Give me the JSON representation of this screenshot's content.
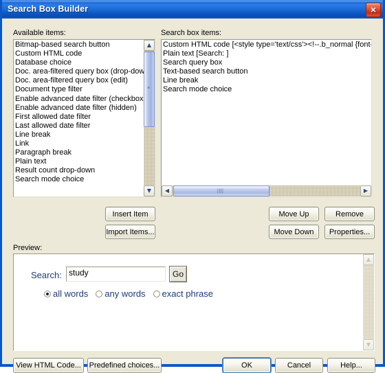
{
  "window": {
    "title": "Search Box Builder",
    "close_icon": "close-icon",
    "close_glyph": "×",
    "titlebar_color": "#1b6ad6",
    "face_color": "#ece9d8"
  },
  "available": {
    "label": "Available items:",
    "items": [
      "Bitmap-based search button",
      "Custom HTML code",
      "Database choice",
      "Doc. area-filtered query box (drop-down)",
      "Doc. area-filtered query box (edit)",
      "Document type filter",
      "Enable advanced date filter (checkbox)",
      "Enable advanced date filter (hidden)",
      "First allowed date filter",
      "Last allowed date filter",
      "Line break",
      "Link",
      "Paragraph break",
      "Plain text",
      "Result count drop-down",
      "Search mode choice"
    ],
    "scrollbar": {
      "up_glyph": "▲",
      "down_glyph": "▼",
      "grip_glyph": "≡"
    }
  },
  "searchbox": {
    "label": "Search box items:",
    "items": [
      "Custom HTML code [<style type='text/css'><!--.b_normal {font-size",
      "Plain text [Search: ]",
      "Search query box",
      "Text-based search button",
      "Line break",
      "Search mode choice"
    ],
    "scrollbar": {
      "left_glyph": "◀",
      "right_glyph": "▶",
      "grip_glyph": "||||"
    }
  },
  "actions": {
    "insert_item": "Insert Item",
    "import_items": "Import Items...",
    "move_up": "Move Up",
    "move_down": "Move Down",
    "remove": "Remove",
    "properties": "Properties..."
  },
  "preview": {
    "label": "Preview:",
    "search_label": "Search:",
    "query_value": "study",
    "query_placeholder": "",
    "go_label": "Go",
    "modes": [
      {
        "label": "all words",
        "selected": true
      },
      {
        "label": "any words",
        "selected": false
      },
      {
        "label": "exact phrase",
        "selected": false
      }
    ],
    "scrollbar": {
      "up_glyph": "▲",
      "down_glyph": "▼"
    }
  },
  "footer": {
    "view_html_code": "View HTML Code...",
    "predefined_choices": "Predefined choices...",
    "ok": "OK",
    "cancel": "Cancel",
    "help": "Help..."
  }
}
